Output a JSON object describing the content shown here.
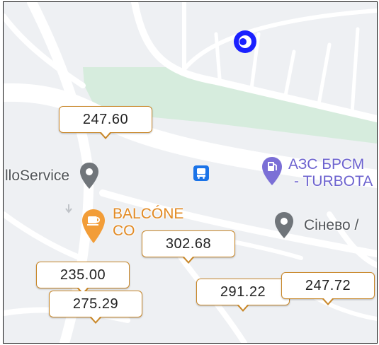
{
  "colors": {
    "map_background": "#eef0f3",
    "road": "#ffffff",
    "park": "#d6ecdd",
    "location_marker": "#1a20ff",
    "poi_grey": "#70757a",
    "poi_purple": "#7b6fd6",
    "poi_orange": "#f29d38",
    "transit_blue": "#1a73e8",
    "callout_border": "#c9882a"
  },
  "location_marker": {
    "icon": "current-location-icon"
  },
  "places": [
    {
      "label": "lloService",
      "icon": "location-pin-icon",
      "color": "#505458"
    },
    {
      "label": "АЗС БРСМ - TURBOTA",
      "line1": "АЗС БРСМ",
      "line2": "- TURBOTA",
      "icon": "gas-station-icon",
      "color": "#6d63cf"
    },
    {
      "label": "BALCÓNE CO",
      "line1": "BALCÓNE",
      "line2": "CO",
      "icon": "cafe-icon",
      "color": "#e28a23"
    },
    {
      "label": "Сінево /",
      "icon": "location-pin-icon",
      "color": "#505458"
    }
  ],
  "transit": {
    "icon": "bus-stop-icon"
  },
  "price_markers": [
    "247.60",
    "302.68",
    "235.00",
    "275.29",
    "291.22",
    "247.72"
  ]
}
